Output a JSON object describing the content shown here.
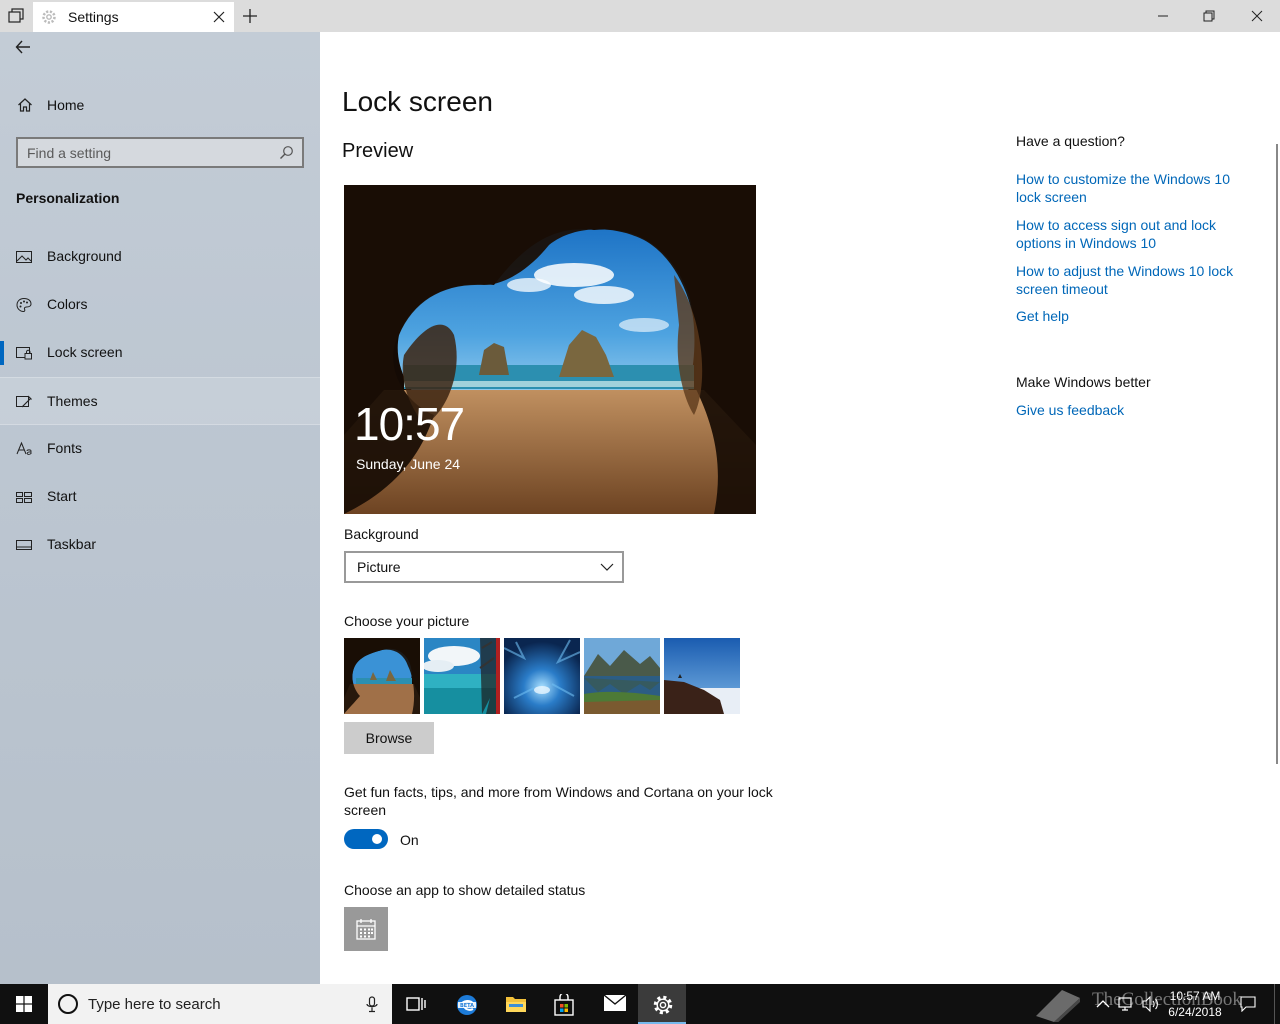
{
  "window": {
    "tab_title": "Settings"
  },
  "sidebar": {
    "home_label": "Home",
    "search_placeholder": "Find a setting",
    "section_title": "Personalization",
    "items": [
      {
        "label": "Background",
        "icon": "picture-icon"
      },
      {
        "label": "Colors",
        "icon": "palette-icon"
      },
      {
        "label": "Lock screen",
        "icon": "lock-screen-icon",
        "selected": true
      },
      {
        "label": "Themes",
        "icon": "themes-icon",
        "hover": true
      },
      {
        "label": "Fonts",
        "icon": "fonts-icon"
      },
      {
        "label": "Start",
        "icon": "start-icon"
      },
      {
        "label": "Taskbar",
        "icon": "taskbar-icon"
      }
    ]
  },
  "main": {
    "title": "Lock screen",
    "preview_title": "Preview",
    "preview_time": "10:57",
    "preview_date": "Sunday, June 24",
    "background_label": "Background",
    "background_value": "Picture",
    "choose_picture_label": "Choose your picture",
    "browse_label": "Browse",
    "fun_facts_label": "Get fun facts, tips, and more from Windows and Cortana on your lock screen",
    "fun_facts_toggle": "On",
    "fun_facts_on": true,
    "detailed_status_label": "Choose an app to show detailed status",
    "detailed_status_icon": "calendar-icon"
  },
  "help": {
    "question_title": "Have a question?",
    "links": [
      "How to customize the Windows 10 lock screen",
      "How to access sign out and lock options in Windows 10",
      "How to adjust the Windows 10 lock screen timeout",
      "Get help"
    ],
    "better_title": "Make Windows better",
    "feedback_link": "Give us feedback"
  },
  "taskbar": {
    "search_placeholder": "Type here to search",
    "time": "10:57 AM",
    "date": "6/24/2018",
    "watermark": "TheCollectionBook",
    "accent": "#0067c0"
  }
}
